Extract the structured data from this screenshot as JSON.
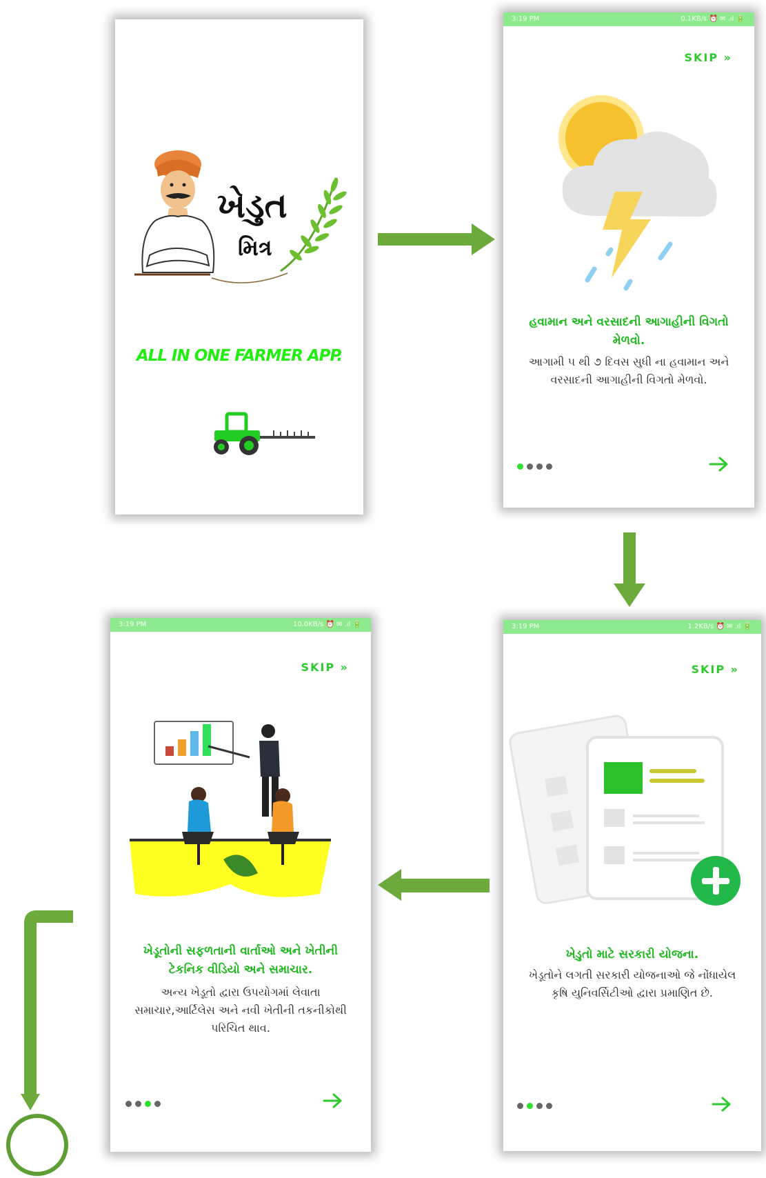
{
  "colors": {
    "accent": "#2ec92e",
    "status_bar": "#8eea8e",
    "flow_arrow": "#6daa3c",
    "tractor": "#22cc22"
  },
  "splash": {
    "logo_title_line1": "ખેડુત",
    "logo_title_line2": "મિત્ર",
    "tagline": "ALL IN ONE FARMER APP."
  },
  "onboarding": [
    {
      "status_time": "3:19 PM",
      "status_right": "0.1KB/s  ⏰ ✉ .ıl 🔋",
      "skip_label": "SKIP  »",
      "illustration": "weather-storm",
      "headline": "હવામાન અને વરસાદની આગાહીની વિગતો મેળવો.",
      "description": "આગામી ૫ થી ૭ દિવસ સુધી ના હવામાન અને વરસાદની આગાહીની વિગતો મેળવો.",
      "active_dot": 0,
      "next_icon": "arrow-right-icon"
    },
    {
      "status_time": "3:19 PM",
      "status_right": "1.2KB/s  ⏰ ✉ .ıl 🔋",
      "skip_label": "SKIP  »",
      "illustration": "documents-add",
      "headline": "ખેડુતો માટે સરકારી યોજના.",
      "description": "ખેડૂતોને લગતી સરકારી યોજનાઓ જે નોંધાયેલ કૃષિ યુનિવર્સિટીઓ દ્વારા પ્રમાણિત છે.",
      "active_dot": 1,
      "next_icon": "arrow-right-icon"
    },
    {
      "status_time": "3:19 PM",
      "status_right": "10.0KB/s  ⏰ ✉ .ıl 🔋",
      "skip_label": "SKIP  »",
      "illustration": "presentation-meeting",
      "headline": "ખેડૂતોની સફળતાની વાર્તાઓ અને ખેતીની ટેકનિક વીડિયો અને સમાચાર.",
      "description": "અન્ય ખેડૂતો દ્વારા ઉપયોગમાં લેવાતા સમાચાર,આર્ટિલેસ અને નવી ખેતીની તકનીકોથી પરિચિત થાવ.",
      "active_dot": 2,
      "next_icon": "arrow-right-icon"
    }
  ],
  "flow": {
    "arrows": [
      "right",
      "down",
      "left",
      "down-end"
    ],
    "end_marker": "circle-end-icon"
  }
}
